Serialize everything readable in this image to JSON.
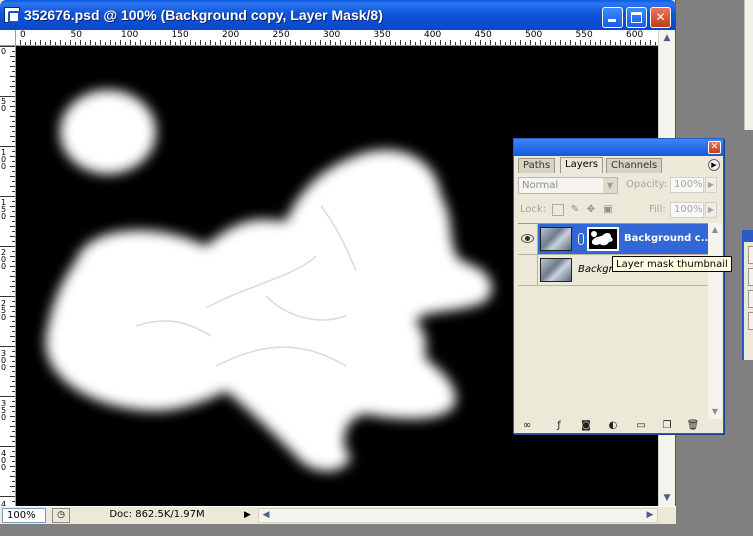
{
  "window": {
    "title": "352676.psd @ 100% (Background copy, Layer Mask/8)",
    "minimize_label": "",
    "maximize_label": "",
    "close_label": "✕"
  },
  "rulers": {
    "top_labels": [
      "0",
      "50",
      "100",
      "150",
      "200",
      "250",
      "300",
      "350",
      "400",
      "450",
      "500",
      "550",
      "600"
    ],
    "left_labels": [
      "0",
      "5 0",
      "1 0 0",
      "1 5 0",
      "2 0 0",
      "2 5 0",
      "3 0 0",
      "3 5 0",
      "4 0 0",
      "4 5 0"
    ]
  },
  "status": {
    "zoom": "100%",
    "doc_info": "Doc: 862.5K/1.97M",
    "arrow": "▶"
  },
  "layers_panel": {
    "tabs": [
      "Paths",
      "Layers",
      "Channels"
    ],
    "active_tab": "Layers",
    "blend_mode": "Normal",
    "opacity_label": "Opacity:",
    "opacity_value": "100%",
    "lock_label": "Lock:",
    "fill_label": "Fill:",
    "fill_value": "100%",
    "layers": [
      {
        "name": "Background c...",
        "selected": true,
        "visible": true,
        "has_mask": true
      },
      {
        "name": "Background",
        "selected": false,
        "visible": false,
        "has_mask": false
      }
    ],
    "tooltip": "Layer mask thumbnail",
    "close_label": "✕"
  },
  "icons": {
    "eye": "eye-icon",
    "link": "chain-link-icon",
    "lock_transparent": "checkerboard-lock-icon",
    "lock_brush": "brush-icon",
    "lock_move": "move-icon",
    "lock_all": "padlock-icon"
  }
}
